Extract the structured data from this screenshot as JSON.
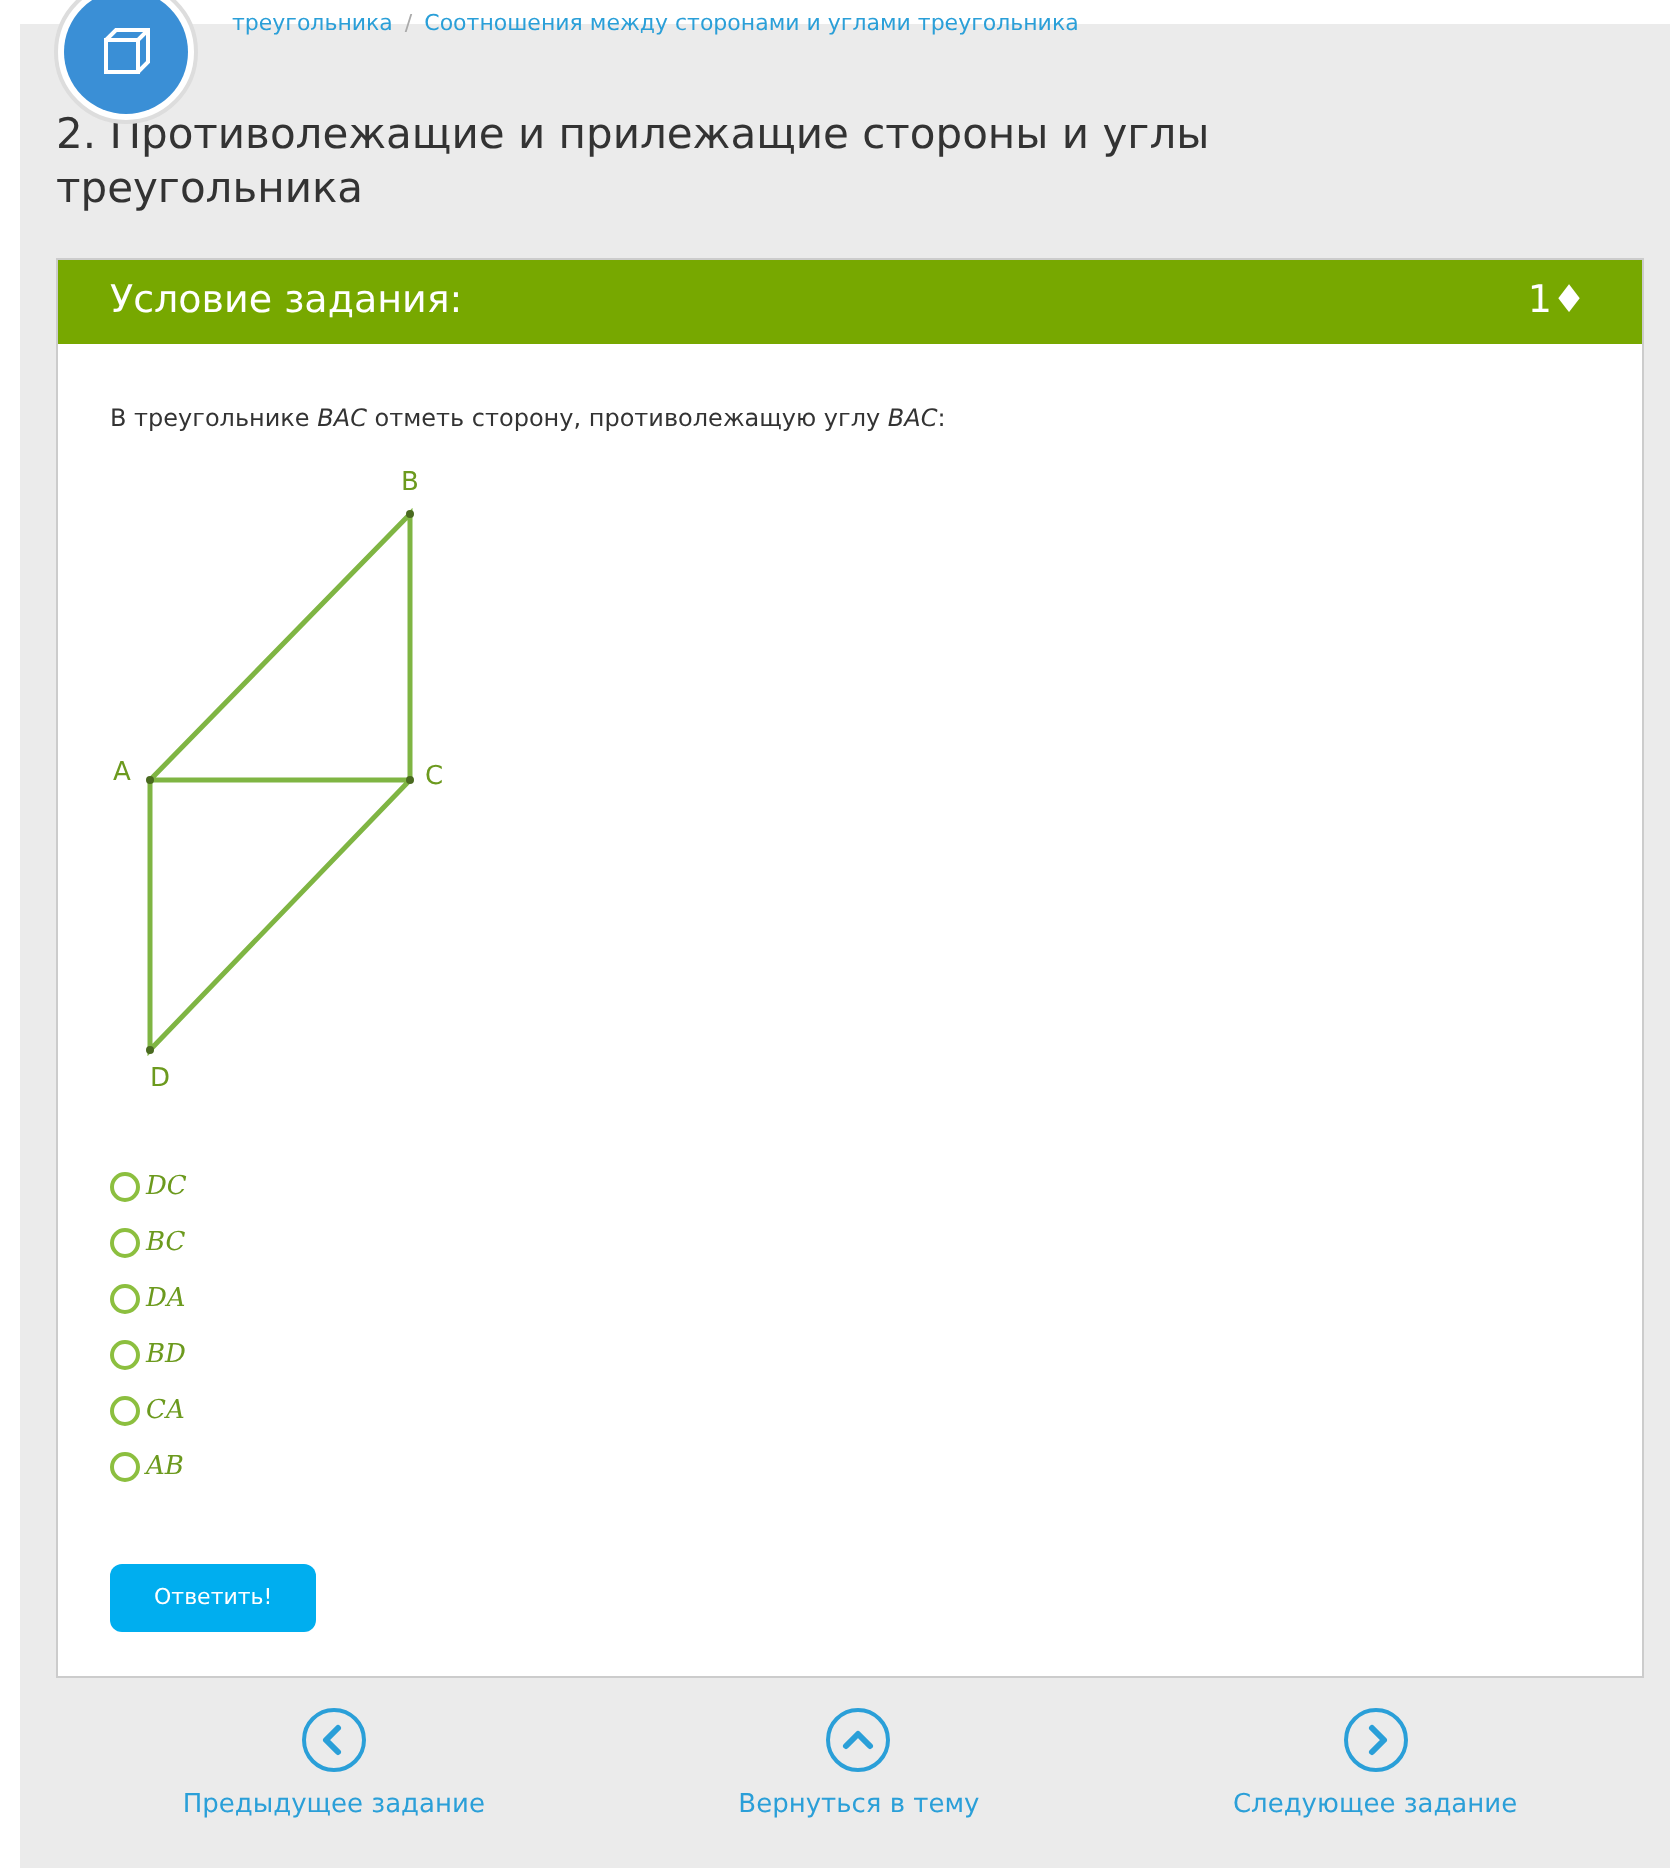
{
  "breadcrumb": [
    {
      "label": "треугольника"
    },
    {
      "label": "Соотношения между сторонами и углами треугольника"
    }
  ],
  "breadcrumb_separator": "/",
  "title": "2. Противолежащие и прилежащие стороны и углы треугольника",
  "task": {
    "header": "Условие задания:",
    "points": "1♦",
    "question": "В треугольнике *BAC* отметь сторону, противолежащую углу *BAC*:",
    "diagram": {
      "points": [
        {
          "label": "B"
        },
        {
          "label": "A"
        },
        {
          "label": "C"
        },
        {
          "label": "D"
        }
      ]
    },
    "options": [
      {
        "label": "DC",
        "selected": false
      },
      {
        "label": "BC",
        "selected": false
      },
      {
        "label": "DA",
        "selected": false
      },
      {
        "label": "BD",
        "selected": false
      },
      {
        "label": "CA",
        "selected": false
      },
      {
        "label": "AB",
        "selected": false
      }
    ],
    "submit": "Ответить!"
  },
  "nav": [
    {
      "kind": "prev",
      "label": "Предыдущее задание"
    },
    {
      "kind": "up",
      "label": "Вернуться в тему"
    },
    {
      "kind": "next",
      "label": "Следующее задание"
    }
  ]
}
